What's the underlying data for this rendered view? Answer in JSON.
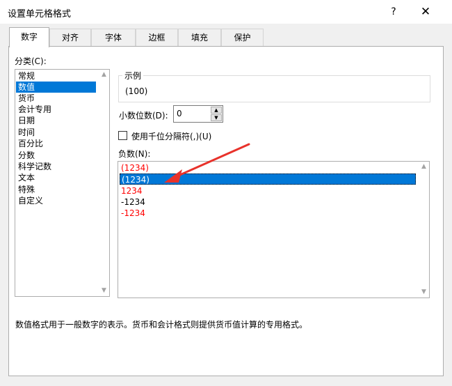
{
  "dialog": {
    "title": "设置单元格格式",
    "help_label": "?",
    "close_label": "✕"
  },
  "tabs": [
    {
      "label": "数字",
      "active": true
    },
    {
      "label": "对齐"
    },
    {
      "label": "字体"
    },
    {
      "label": "边框"
    },
    {
      "label": "填充"
    },
    {
      "label": "保护"
    }
  ],
  "category": {
    "label": "分类(C):",
    "items": [
      "常规",
      "数值",
      "货币",
      "会计专用",
      "日期",
      "时间",
      "百分比",
      "分数",
      "科学记数",
      "文本",
      "特殊",
      "自定义"
    ],
    "selected": "数值"
  },
  "sample": {
    "label": "示例",
    "value": "(100)"
  },
  "decimal_places": {
    "label": "小数位数(D):",
    "value": "0"
  },
  "thousands_separator": {
    "label": "使用千位分隔符(,)(U)",
    "checked": false
  },
  "negative_numbers": {
    "label": "负数(N):",
    "items": [
      {
        "text": "(1234)",
        "color": "#ff0000"
      },
      {
        "text": "(1234)",
        "color": "#ffffff",
        "selected": true
      },
      {
        "text": "1234",
        "color": "#ff0000"
      },
      {
        "text": "-1234",
        "color": "#000000"
      },
      {
        "text": "-1234",
        "color": "#ff0000"
      }
    ]
  },
  "description": "数值格式用于一般数字的表示。货币和会计格式则提供货币值计算的专用格式。",
  "colors": {
    "selection": "#0078d7",
    "annotation_arrow": "#e8322b"
  }
}
